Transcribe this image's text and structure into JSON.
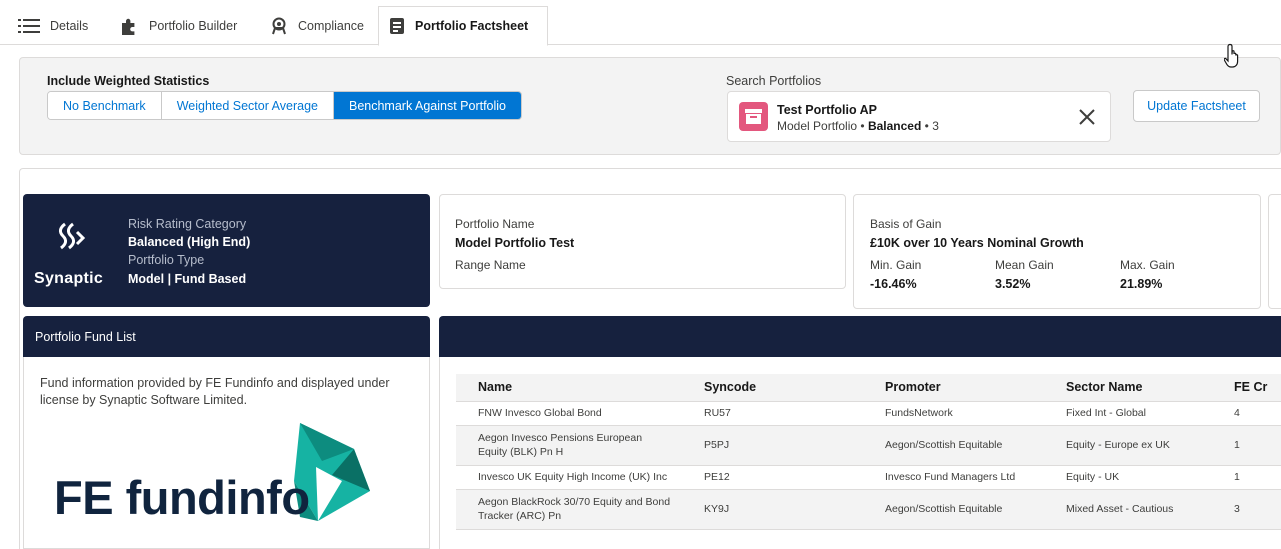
{
  "tabs": [
    {
      "label": "Details",
      "icon": "list-icon"
    },
    {
      "label": "Portfolio Builder",
      "icon": "puzzle-icon"
    },
    {
      "label": "Compliance",
      "icon": "award-icon"
    },
    {
      "label": "Portfolio Factsheet",
      "icon": "factsheet-icon"
    }
  ],
  "active_tab": "Portfolio Factsheet",
  "weighted": {
    "title": "Include Weighted Statistics",
    "options": [
      "No Benchmark",
      "Weighted Sector Average",
      "Benchmark Against Portfolio"
    ],
    "selected": "Benchmark Against Portfolio"
  },
  "search": {
    "label": "Search Portfolios",
    "selected_title": "Test Portfolio AP",
    "selected_type": "Model Portfolio",
    "selected_sep1": "•",
    "selected_risk": "Balanced",
    "selected_sep2": "•",
    "selected_level": "3",
    "pill_icon_color": "#e3577e"
  },
  "update_button": "Update Factsheet",
  "risk_card": {
    "logo_text": "Synaptic",
    "risk_label": "Risk Rating Category",
    "risk_value": "Balanced (High End)",
    "type_label": "Portfolio Type",
    "type_value": "Model | Fund Based",
    "background": "#16213e"
  },
  "portfolio_card": {
    "name_label": "Portfolio Name",
    "name_value": "Model Portfolio Test",
    "range_label": "Range Name"
  },
  "gain_card": {
    "basis_label": "Basis of Gain",
    "basis_value": "£10K over 10 Years Nominal Growth",
    "min_label": "Min. Gain",
    "min_value": "-16.46%",
    "mean_label": "Mean Gain",
    "mean_value": "3.52%",
    "max_label": "Max. Gain",
    "max_value": "21.89%"
  },
  "fund_list": {
    "title": "Portfolio Fund List",
    "note": "Fund information provided by FE Fundinfo and displayed under license by Synaptic Software Limited.",
    "logo_text": "FE fundinfo",
    "logo_colors": [
      "#0d8c7f",
      "#16b3a3",
      "#10243e"
    ]
  },
  "fund_table": {
    "columns": [
      "Name",
      "Syncode",
      "Promoter",
      "Sector Name",
      "FE Cr"
    ],
    "rows": [
      [
        "FNW Invesco Global Bond",
        "RU57",
        "FundsNetwork",
        "Fixed Int - Global",
        "4"
      ],
      [
        "Aegon Invesco Pensions European Equity (BLK) Pn H",
        "P5PJ",
        "Aegon/Scottish Equitable",
        "Equity - Europe ex UK",
        "1"
      ],
      [
        "Invesco UK Equity High Income (UK) Inc",
        "PE12",
        "Invesco Fund Managers Ltd",
        "Equity - UK",
        "1"
      ],
      [
        "Aegon BlackRock 30/70 Equity and Bond Tracker (ARC) Pn",
        "KY9J",
        "Aegon/Scottish Equitable",
        "Mixed Asset - Cautious",
        "3"
      ]
    ]
  },
  "colors": {
    "brand_blue": "#0176d3",
    "navy": "#16213e",
    "border": "#dddbda"
  }
}
